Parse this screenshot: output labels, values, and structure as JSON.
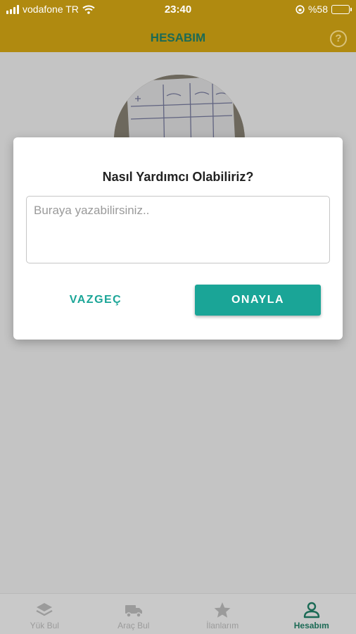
{
  "status": {
    "carrier": "vodafone TR",
    "time": "23:40",
    "battery": "%58",
    "battery_level": 0.58
  },
  "appbar": {
    "title": "HESABIM",
    "help_icon": "question-circle-icon"
  },
  "dialog": {
    "title": "Nasıl Yardımcı Olabiliriz?",
    "input_placeholder": "Buraya yazabilirsiniz..",
    "input_value": "",
    "cancel_label": "VAZGEÇ",
    "confirm_label": "ONAYLA"
  },
  "tabs": [
    {
      "label": "Yük Bul",
      "icon": "layers-icon",
      "active": false
    },
    {
      "label": "Araç Bul",
      "icon": "truck-icon",
      "active": false
    },
    {
      "label": "İlanlarım",
      "icon": "star-icon",
      "active": false
    },
    {
      "label": "Hesabım",
      "icon": "user-icon",
      "active": true
    }
  ],
  "colors": {
    "brand": "#b08a10",
    "accent": "#1aa597",
    "title_green": "#1b6a55"
  }
}
